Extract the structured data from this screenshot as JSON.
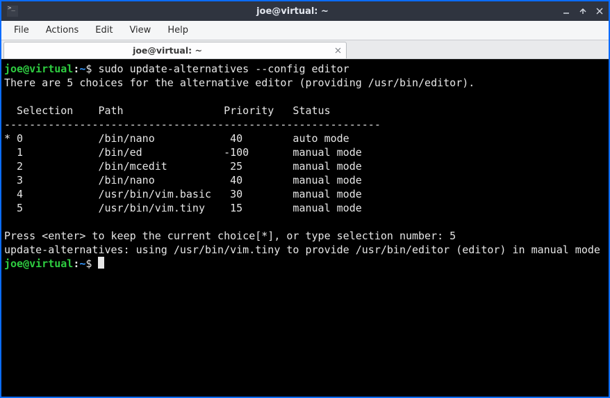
{
  "window": {
    "title": "joe@virtual: ~"
  },
  "menubar": {
    "items": [
      "File",
      "Actions",
      "Edit",
      "View",
      "Help"
    ]
  },
  "tab": {
    "label": "joe@virtual: ~"
  },
  "prompt": {
    "user_host": "joe@virtual",
    "colon": ":",
    "cwd": "~",
    "sigil": "$"
  },
  "session": {
    "command1": "sudo update-alternatives --config editor",
    "intro": "There are 5 choices for the alternative editor (providing /usr/bin/editor).",
    "header": "  Selection    Path                Priority   Status",
    "separator": "------------------------------------------------------------",
    "rows": [
      "* 0            /bin/nano            40        auto mode",
      "  1            /bin/ed             -100       manual mode",
      "  2            /bin/mcedit          25        manual mode",
      "  3            /bin/nano            40        manual mode",
      "  4            /usr/bin/vim.basic   30        manual mode",
      "  5            /usr/bin/vim.tiny    15        manual mode"
    ],
    "prompt_line": "Press <enter> to keep the current choice[*], or type selection number: 5",
    "result": "update-alternatives: using /usr/bin/vim.tiny to provide /usr/bin/editor (editor) in manual mode"
  }
}
